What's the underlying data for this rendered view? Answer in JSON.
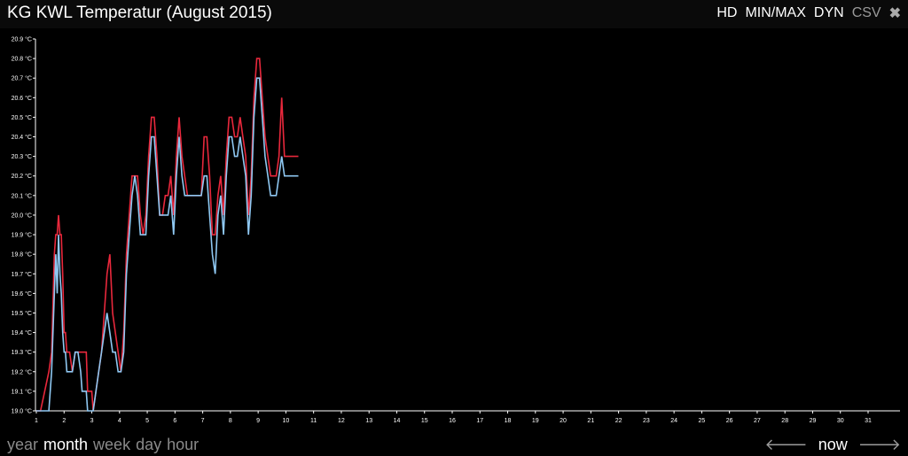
{
  "header": {
    "title": "KG KWL Temperatur (August 2015)",
    "actions": [
      {
        "label": "HD"
      },
      {
        "label": "MIN/MAX"
      },
      {
        "label": "DYN"
      },
      {
        "label": "CSV"
      }
    ],
    "close_icon": "close-icon"
  },
  "footer": {
    "tabs": [
      {
        "label": "year",
        "active": false
      },
      {
        "label": "month",
        "active": true
      },
      {
        "label": "week",
        "active": false
      },
      {
        "label": "day",
        "active": false
      },
      {
        "label": "hour",
        "active": false
      }
    ],
    "prev_icon": "arrow-left-icon",
    "now_label": "now",
    "next_icon": "arrow-right-icon"
  },
  "colors": {
    "background": "#000000",
    "max_series": "#e8283c",
    "min_series": "#8fc8f2",
    "axis": "#ffffff"
  },
  "chart_data": {
    "type": "line",
    "title": "KG KWL Temperatur (August 2015)",
    "xlabel": "",
    "ylabel": "",
    "xlim": [
      1,
      31
    ],
    "ylim": [
      19.0,
      20.9
    ],
    "x_ticks": [
      "1",
      "2",
      "3",
      "4",
      "5",
      "6",
      "7",
      "8",
      "9",
      "10",
      "11",
      "12",
      "13",
      "14",
      "15",
      "16",
      "17",
      "18",
      "19",
      "20",
      "21",
      "22",
      "23",
      "24",
      "25",
      "26",
      "27",
      "28",
      "29",
      "30",
      "31"
    ],
    "y_ticks": [
      "19.0 °C",
      "19.1 °C",
      "19.2 °C",
      "19.3 °C",
      "19.4 °C",
      "19.5 °C",
      "19.6 °C",
      "19.7 °C",
      "19.8 °C",
      "19.9 °C",
      "20.0 °C",
      "20.1 °C",
      "20.2 °C",
      "20.3 °C",
      "20.4 °C",
      "20.5 °C",
      "20.6 °C",
      "20.7 °C",
      "20.8 °C",
      "20.9 °C"
    ],
    "grid": false,
    "series": [
      {
        "color": "#e8283c",
        "x": [
          1.0,
          1.15,
          1.3,
          1.45,
          1.55,
          1.65,
          1.7,
          1.75,
          1.8,
          1.85,
          1.9,
          1.95,
          2.0,
          2.05,
          2.1,
          2.2,
          2.3,
          2.4,
          2.5,
          2.6,
          2.65,
          2.7,
          2.8,
          2.85,
          2.9,
          3.0,
          3.05,
          3.15,
          3.25,
          3.35,
          3.45,
          3.55,
          3.65,
          3.75,
          3.85,
          3.95,
          4.05,
          4.15,
          4.25,
          4.35,
          4.45,
          4.55,
          4.65,
          4.75,
          4.85,
          4.95,
          5.05,
          5.15,
          5.25,
          5.35,
          5.45,
          5.55,
          5.65,
          5.75,
          5.85,
          5.95,
          6.05,
          6.15,
          6.25,
          6.35,
          6.45,
          6.55,
          6.65,
          6.75,
          6.85,
          6.95,
          7.05,
          7.15,
          7.25,
          7.35,
          7.45,
          7.55,
          7.65,
          7.75,
          7.85,
          7.95,
          8.0,
          8.05,
          8.15,
          8.25,
          8.35,
          8.45,
          8.55,
          8.65,
          8.75,
          8.85,
          8.95,
          9.05,
          9.15,
          9.25,
          9.35,
          9.45,
          9.55,
          9.65,
          9.75,
          9.85,
          9.95,
          10.05,
          10.15,
          10.25,
          10.35,
          10.45
        ],
        "y": [
          19.0,
          19.0,
          19.1,
          19.2,
          19.3,
          19.8,
          19.9,
          19.9,
          20.0,
          19.9,
          19.9,
          19.7,
          19.4,
          19.4,
          19.3,
          19.3,
          19.2,
          19.3,
          19.3,
          19.3,
          19.3,
          19.3,
          19.3,
          19.1,
          19.1,
          19.1,
          19.0,
          19.1,
          19.2,
          19.3,
          19.5,
          19.7,
          19.8,
          19.5,
          19.4,
          19.3,
          19.2,
          19.4,
          19.8,
          20.0,
          20.2,
          20.2,
          20.2,
          20.0,
          19.9,
          20.0,
          20.3,
          20.5,
          20.5,
          20.3,
          20.0,
          20.0,
          20.1,
          20.1,
          20.2,
          20.0,
          20.3,
          20.5,
          20.3,
          20.2,
          20.1,
          20.1,
          20.1,
          20.1,
          20.1,
          20.1,
          20.4,
          20.4,
          20.2,
          19.9,
          19.9,
          20.1,
          20.2,
          20.0,
          20.3,
          20.5,
          20.5,
          20.5,
          20.4,
          20.4,
          20.5,
          20.4,
          20.3,
          20.0,
          20.2,
          20.6,
          20.8,
          20.8,
          20.6,
          20.4,
          20.3,
          20.2,
          20.2,
          20.2,
          20.3,
          20.6,
          20.3,
          20.3,
          20.3,
          20.3,
          20.3,
          20.3
        ]
      },
      {
        "color": "#8fc8f2",
        "x": [
          1.0,
          1.15,
          1.3,
          1.45,
          1.55,
          1.65,
          1.7,
          1.75,
          1.8,
          1.85,
          1.9,
          1.95,
          2.0,
          2.05,
          2.1,
          2.2,
          2.3,
          2.4,
          2.5,
          2.6,
          2.65,
          2.7,
          2.8,
          2.85,
          2.9,
          3.0,
          3.05,
          3.15,
          3.25,
          3.35,
          3.45,
          3.55,
          3.65,
          3.75,
          3.85,
          3.95,
          4.05,
          4.15,
          4.25,
          4.35,
          4.45,
          4.55,
          4.65,
          4.75,
          4.85,
          4.95,
          5.05,
          5.15,
          5.25,
          5.35,
          5.45,
          5.55,
          5.65,
          5.75,
          5.85,
          5.95,
          6.05,
          6.15,
          6.25,
          6.35,
          6.45,
          6.55,
          6.65,
          6.75,
          6.85,
          6.95,
          7.05,
          7.15,
          7.25,
          7.35,
          7.45,
          7.55,
          7.65,
          7.75,
          7.85,
          7.95,
          8.0,
          8.05,
          8.15,
          8.25,
          8.35,
          8.45,
          8.55,
          8.65,
          8.75,
          8.85,
          8.95,
          9.05,
          9.15,
          9.25,
          9.35,
          9.45,
          9.55,
          9.65,
          9.75,
          9.85,
          9.95,
          10.05,
          10.15,
          10.25,
          10.35,
          10.45
        ],
        "y": [
          19.0,
          19.0,
          19.0,
          19.0,
          19.2,
          19.6,
          19.8,
          19.6,
          19.9,
          19.7,
          19.6,
          19.4,
          19.3,
          19.3,
          19.2,
          19.2,
          19.2,
          19.3,
          19.3,
          19.2,
          19.1,
          19.1,
          19.1,
          19.0,
          19.0,
          19.0,
          19.0,
          19.1,
          19.2,
          19.3,
          19.4,
          19.5,
          19.4,
          19.3,
          19.3,
          19.2,
          19.2,
          19.3,
          19.7,
          19.9,
          20.1,
          20.2,
          20.1,
          19.9,
          19.9,
          19.9,
          20.2,
          20.4,
          20.4,
          20.2,
          20.0,
          20.0,
          20.0,
          20.0,
          20.1,
          19.9,
          20.2,
          20.4,
          20.2,
          20.1,
          20.1,
          20.1,
          20.1,
          20.1,
          20.1,
          20.1,
          20.2,
          20.2,
          20.0,
          19.8,
          19.7,
          20.0,
          20.1,
          19.9,
          20.2,
          20.4,
          20.4,
          20.4,
          20.3,
          20.3,
          20.4,
          20.3,
          20.2,
          19.9,
          20.1,
          20.5,
          20.7,
          20.7,
          20.5,
          20.3,
          20.2,
          20.1,
          20.1,
          20.1,
          20.2,
          20.3,
          20.2,
          20.2,
          20.2,
          20.2,
          20.2,
          20.2
        ]
      }
    ]
  }
}
